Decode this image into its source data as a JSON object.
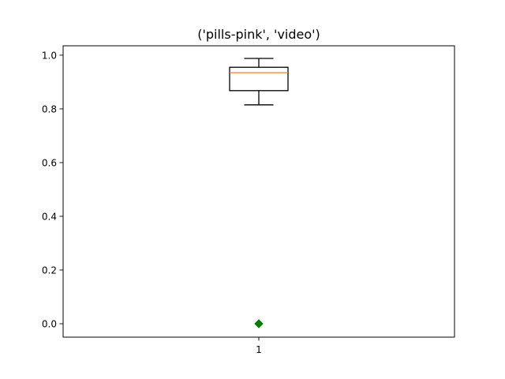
{
  "chart_data": {
    "type": "box",
    "title": "('pills-pink', 'video')",
    "xlabel": "",
    "ylabel": "",
    "categories": [
      "1"
    ],
    "ylim": [
      -0.05,
      1.035
    ],
    "yticks": [
      0.0,
      0.2,
      0.4,
      0.6,
      0.8,
      1.0
    ],
    "ytick_labels": [
      "0.0",
      "0.2",
      "0.4",
      "0.6",
      "0.8",
      "1.0"
    ],
    "grid": false,
    "boxes": [
      {
        "category": "1",
        "whisker_low": 0.815,
        "q1": 0.868,
        "median": 0.935,
        "q3": 0.955,
        "whisker_high": 0.988,
        "outliers": [
          0.0
        ]
      }
    ],
    "colors": {
      "box": "#000000",
      "median": "#ff7f0e",
      "outlier": "#008000"
    }
  }
}
